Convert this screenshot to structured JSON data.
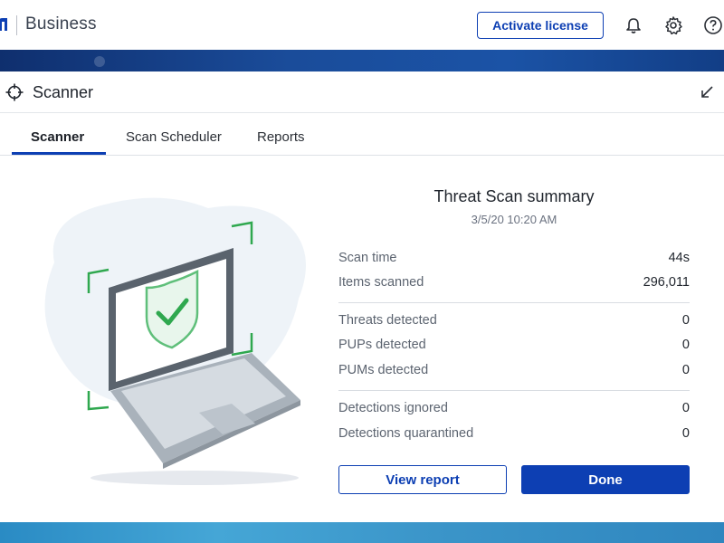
{
  "header": {
    "brand": "Business",
    "activate_label": "Activate license",
    "icons": [
      "logo-icon",
      "bell-icon",
      "gear-icon",
      "help-icon"
    ]
  },
  "panel": {
    "title": "Scanner",
    "icons": [
      "scanner-crosshair-icon",
      "minimize-icon"
    ]
  },
  "tabs": [
    {
      "label": "Scanner",
      "active": true
    },
    {
      "label": "Scan Scheduler",
      "active": false
    },
    {
      "label": "Reports",
      "active": false
    }
  ],
  "summary": {
    "title": "Threat Scan summary",
    "date": "3/5/20 10:20 AM",
    "scan_time_label": "Scan time",
    "scan_time_value": "44s",
    "items_scanned_label": "Items scanned",
    "items_scanned_value": "296,011",
    "threats_label": "Threats detected",
    "threats_value": "0",
    "pups_label": "PUPs detected",
    "pups_value": "0",
    "pums_label": "PUMs detected",
    "pums_value": "0",
    "ignored_label": "Detections ignored",
    "ignored_value": "0",
    "quarantined_label": "Detections quarantined",
    "quarantined_value": "0"
  },
  "buttons": {
    "view_report": "View report",
    "done": "Done"
  },
  "colors": {
    "accent": "#0d3fb3",
    "band": "#1a4c9a",
    "bottom_band": "#3b95c9",
    "shield_green": "#2fa84f"
  }
}
